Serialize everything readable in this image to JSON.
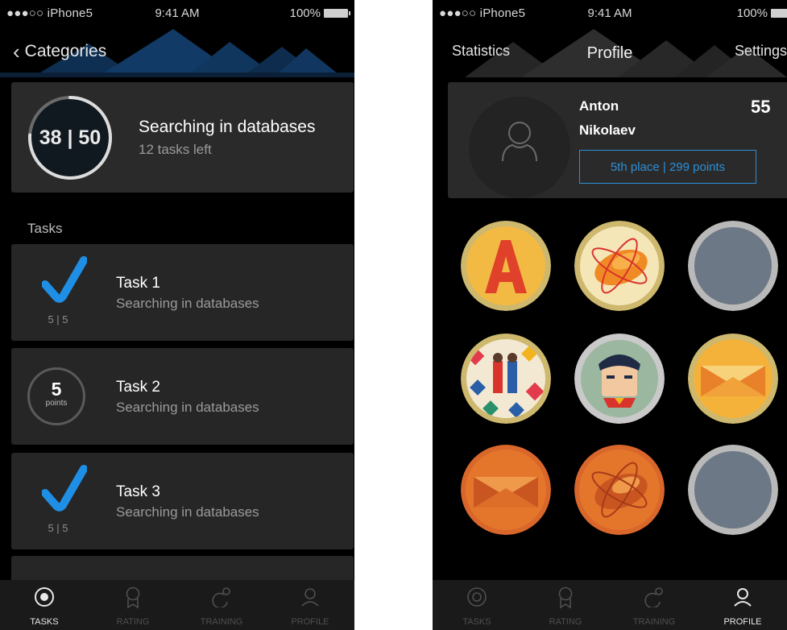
{
  "left": {
    "status": {
      "carrier": "●●●○○ iPhone5",
      "time": "9:41 AM",
      "battery": "100%"
    },
    "nav": {
      "back_label": "Categories"
    },
    "category": {
      "progress": "38 | 50",
      "done": 38,
      "total": 50,
      "title": "Searching in databases",
      "subtitle": "12 tasks left"
    },
    "section_label": "Tasks",
    "tasks": [
      {
        "title": "Task 1",
        "subtitle": "Searching in databases",
        "status": "done",
        "score": "5 | 5"
      },
      {
        "title": "Task 2",
        "subtitle": "Searching in databases",
        "status": "points",
        "points": "5",
        "points_unit": "points"
      },
      {
        "title": "Task 3",
        "subtitle": "Searching in databases",
        "status": "done",
        "score": "5 | 5"
      }
    ],
    "tabs": [
      {
        "label": "TASKS",
        "icon": "target-icon",
        "active": true
      },
      {
        "label": "RATING",
        "icon": "ribbon-icon",
        "active": false
      },
      {
        "label": "TRAINING",
        "icon": "training-icon",
        "active": false
      },
      {
        "label": "PROFILE",
        "icon": "person-icon",
        "active": false
      }
    ]
  },
  "right": {
    "status": {
      "carrier": "●●●○○ iPhone5",
      "time": "9:41 AM",
      "battery": "100%"
    },
    "nav": {
      "left": "Statistics",
      "title": "Profile",
      "right": "Settings"
    },
    "profile": {
      "first_name": "Anton",
      "last_name": "Nikolaev",
      "score": "55",
      "rank": "5th place | 299 points"
    },
    "badges": [
      "letter-a-badge",
      "zeppelin-badge",
      "locked-badge",
      "pattern-badge",
      "superhero-badge",
      "envelope-badge",
      "envelope-badge",
      "zeppelin-badge",
      "locked-badge"
    ],
    "tabs": [
      {
        "label": "TASKS",
        "icon": "target-icon",
        "active": false
      },
      {
        "label": "RATING",
        "icon": "ribbon-icon",
        "active": false
      },
      {
        "label": "TRAINING",
        "icon": "training-icon",
        "active": false
      },
      {
        "label": "PROFILE",
        "icon": "person-icon",
        "active": true
      }
    ]
  },
  "colors": {
    "accent": "#2c8fd8",
    "check": "#1f8fe6",
    "card": "#2a2a2a",
    "background": "#000000"
  }
}
